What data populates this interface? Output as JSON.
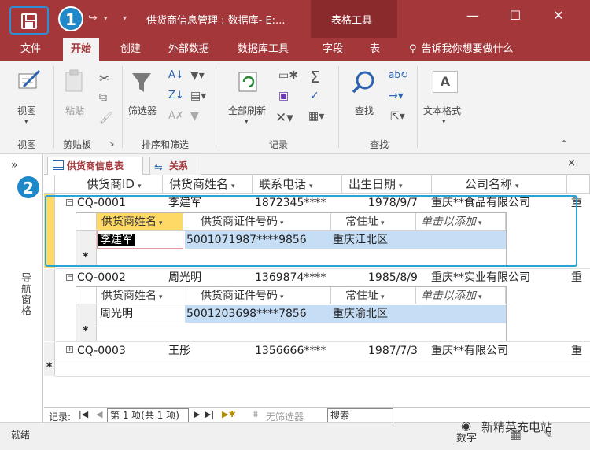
{
  "titlebar": {
    "title": "供货商信息管理 : 数据库- E:...",
    "context_tab": "表格工具",
    "minimize_glyph": "—",
    "maximize_glyph": "☐",
    "close_glyph": "✕"
  },
  "annotations": {
    "badge1": "1",
    "badge2": "2"
  },
  "ribbon_tabs": [
    "文件",
    "开始",
    "创建",
    "外部数据",
    "数据库工具",
    "字段",
    "表"
  ],
  "tell_me": "告诉我你想要做什么",
  "ribbon": {
    "view_btn": "视图",
    "paste_btn": "粘贴",
    "filter_btn": "筛选器",
    "refresh_btn": "全部刷新",
    "find_btn": "查找",
    "textformat_btn": "文本格式",
    "groups": {
      "view": "视图",
      "clipboard": "剪贴板",
      "sort_filter": "排序和筛选",
      "records": "记录",
      "find": "查找"
    }
  },
  "nav_pane": {
    "toggle": "»",
    "label": "导航窗格"
  },
  "object_tabs": [
    {
      "label": "供货商信息表",
      "icon": "table-icon"
    },
    {
      "label": "关系",
      "icon": "relationship-icon"
    }
  ],
  "close_tab": "×",
  "columns": [
    "供货商ID",
    "供货商姓名",
    "联系电话",
    "出生日期",
    "公司名称"
  ],
  "rows": [
    {
      "id": "CQ-0001",
      "name": "李建军",
      "phone": "1872345****",
      "birth": "1978/9/7",
      "company": "重庆**食品有限公司",
      "extra": "重",
      "subtable": {
        "columns": [
          "供货商姓名",
          "供货商证件号码",
          "常住址",
          "单击以添加"
        ],
        "rows": [
          {
            "name": "李建军",
            "idno": "5001071987****9856",
            "addr": "重庆江北区"
          }
        ],
        "new_marker": "*"
      }
    },
    {
      "id": "CQ-0002",
      "name": "周光明",
      "phone": "1369874****",
      "birth": "1985/8/9",
      "company": "重庆**实业有限公司",
      "extra": "重",
      "subtable": {
        "columns": [
          "供货商姓名",
          "供货商证件号码",
          "常住址",
          "单击以添加"
        ],
        "rows": [
          {
            "name": "周光明",
            "idno": "5001203698****7856",
            "addr": "重庆渝北区"
          }
        ],
        "new_marker": "*"
      }
    },
    {
      "id": "CQ-0003",
      "name": "王彤",
      "phone": "1356666****",
      "birth": "1987/7/3",
      "company": "重庆**有限公司",
      "extra": "重"
    }
  ],
  "new_row_marker": "*",
  "record_nav": {
    "label": "记录:",
    "position": "第 1 项(共 1 项)",
    "filter": "无筛选器",
    "search": "搜索"
  },
  "status": {
    "ready": "就绪",
    "mode": "数字",
    "watermark": "新精英充电站"
  },
  "colors": {
    "accent": "#a4373a",
    "highlight": "#29a3d8",
    "selected_field": "#c5ddf5",
    "current_row": "#ffd966"
  }
}
